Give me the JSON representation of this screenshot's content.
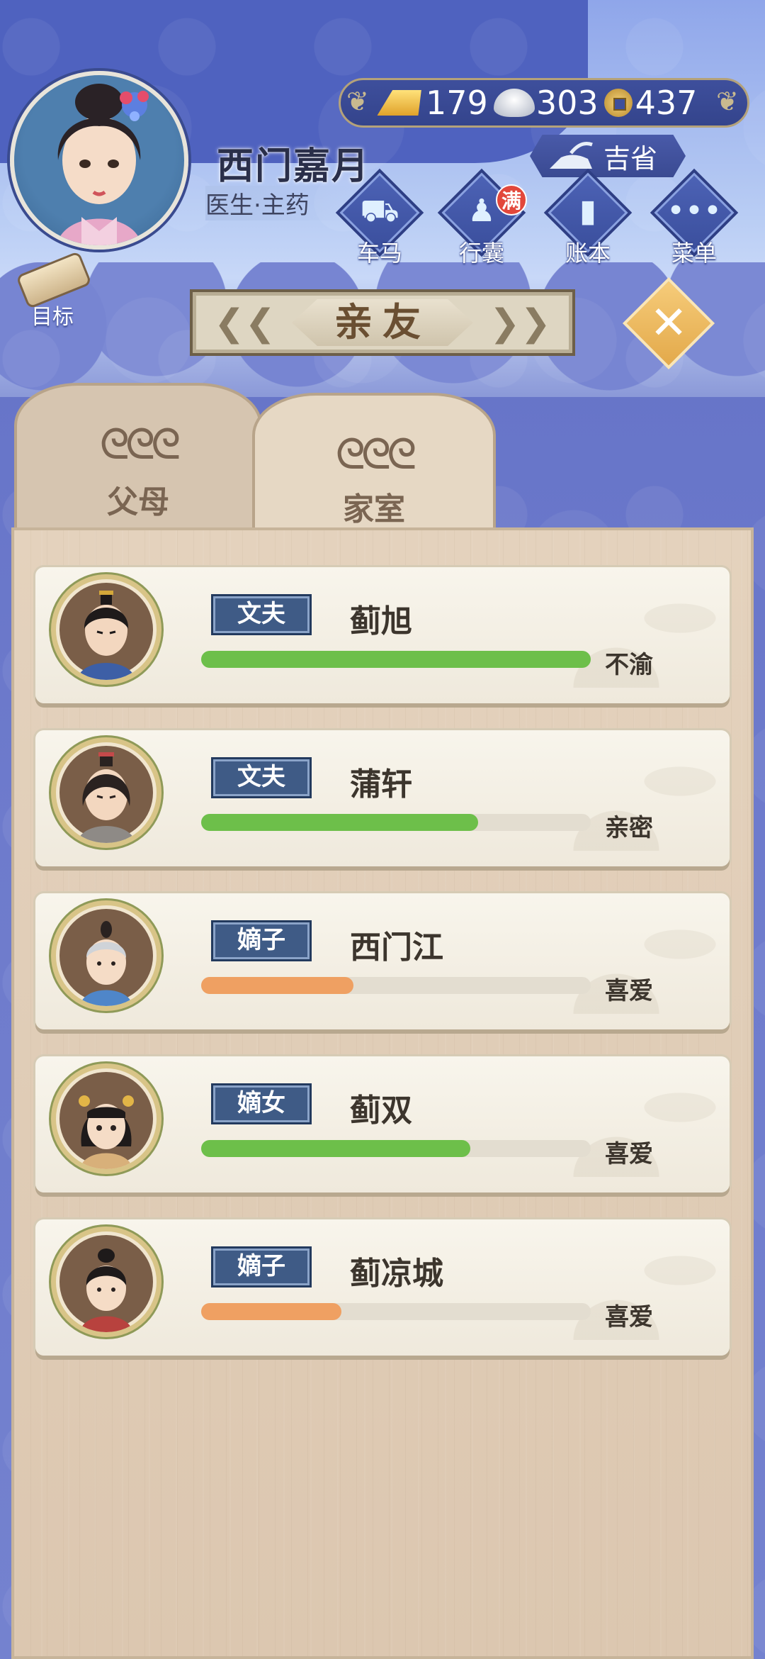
{
  "player": {
    "name": "西门嘉月",
    "role": "医生·主药"
  },
  "currency": {
    "gold": "179",
    "silver": "303",
    "coin": "437"
  },
  "status": {
    "text": "吉省"
  },
  "nav": [
    {
      "label": "车马",
      "icon": "carriage-icon"
    },
    {
      "label": "行囊",
      "icon": "bag-icon",
      "badge": "满"
    },
    {
      "label": "账本",
      "icon": "ledger-icon"
    },
    {
      "label": "菜单",
      "icon": "menu-dots-icon"
    }
  ],
  "goal": {
    "label": "目标"
  },
  "title": "亲友",
  "tabs": [
    {
      "label": "父母"
    },
    {
      "label": "家室"
    }
  ],
  "members": [
    {
      "relation": "文夫",
      "name": "蓟旭",
      "affinity": 1.0,
      "affinity_color": "#6dbf4a",
      "status": "不渝"
    },
    {
      "relation": "文夫",
      "name": "蒲轩",
      "affinity": 0.71,
      "affinity_color": "#6dbf4a",
      "status": "亲密"
    },
    {
      "relation": "嫡子",
      "name": "西门江",
      "affinity": 0.39,
      "affinity_color": "#efa062",
      "status": "喜爱"
    },
    {
      "relation": "嫡女",
      "name": "蓟双",
      "affinity": 0.69,
      "affinity_color": "#6dbf4a",
      "status": "喜爱"
    },
    {
      "relation": "嫡子",
      "name": "蓟凉城",
      "affinity": 0.36,
      "affinity_color": "#efa062",
      "status": "喜爱"
    }
  ]
}
